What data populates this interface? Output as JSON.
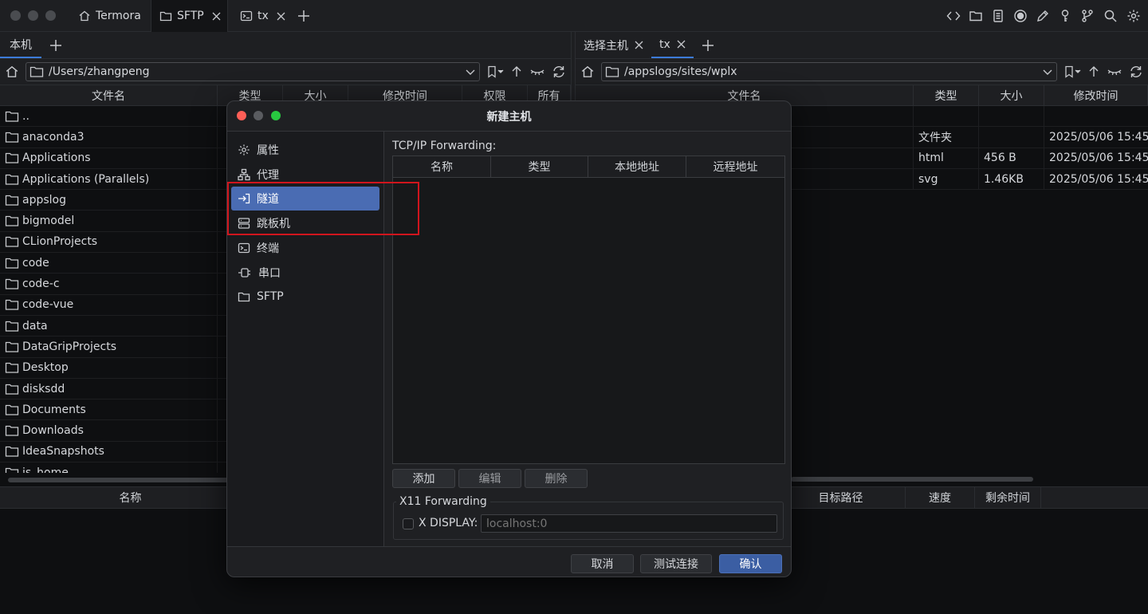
{
  "titlebar": {
    "tabs": [
      {
        "label": "Termora",
        "icon": "home-icon"
      },
      {
        "label": "SFTP",
        "icon": "folder-icon"
      },
      {
        "label": "tx",
        "icon": "terminal-icon"
      }
    ],
    "right_icons": [
      "code-icon",
      "folder-icon",
      "document-icon",
      "record-icon",
      "pen-icon",
      "key-icon",
      "git-branch-icon",
      "search-icon",
      "gear-icon"
    ]
  },
  "left_pane": {
    "tab_label": "本机",
    "path": "/Users/zhangpeng",
    "columns": [
      "文件名",
      "类型",
      "大小",
      "修改时间",
      "权限",
      "所有"
    ],
    "files": [
      "..",
      "anaconda3",
      "Applications",
      "Applications (Parallels)",
      "appslog",
      "bigmodel",
      "CLionProjects",
      "code",
      "code-c",
      "code-vue",
      "data",
      "DataGripProjects",
      "Desktop",
      "disksdd",
      "Documents",
      "Downloads",
      "IdeaSnapshots",
      "js_home"
    ]
  },
  "right_pane": {
    "tabs": [
      "选择主机",
      "tx"
    ],
    "path": "/appslogs/sites/wplx",
    "columns": [
      "文件名",
      "类型",
      "大小",
      "修改时间"
    ],
    "rows": [
      {
        "type": "文件夹",
        "size": "",
        "modified": "2025/05/06 15:45"
      },
      {
        "type": "html",
        "size": "456 B",
        "modified": "2025/05/06 15:45"
      },
      {
        "type": "svg",
        "size": "1.46KB",
        "modified": "2025/05/06 15:45"
      }
    ]
  },
  "transfers": {
    "columns": [
      "名称",
      "目标路径",
      "速度",
      "剩余时间"
    ]
  },
  "dialog": {
    "title": "新建主机",
    "nav": [
      {
        "label": "属性",
        "icon": "gear-icon"
      },
      {
        "label": "代理",
        "icon": "network-icon"
      },
      {
        "label": "隧道",
        "icon": "tunnel-icon",
        "selected": true
      },
      {
        "label": "跳板机",
        "icon": "server-icon"
      },
      {
        "label": "终端",
        "icon": "terminal-icon"
      },
      {
        "label": "串口",
        "icon": "plug-icon"
      },
      {
        "label": "SFTP",
        "icon": "folder-icon"
      }
    ],
    "forwarding_label": "TCP/IP Forwarding:",
    "table_columns": [
      "名称",
      "类型",
      "本地地址",
      "远程地址"
    ],
    "table_buttons": [
      "添加",
      "编辑",
      "删除"
    ],
    "x11_label": "X11 Forwarding",
    "x_display_label": "X DISPLAY:",
    "x_display_placeholder": "localhost:0",
    "x_display_checked": false,
    "footer_buttons": {
      "cancel": "取消",
      "test": "测试连接",
      "confirm": "确认"
    }
  },
  "colors": {
    "accent": "#4a6cb3",
    "highlight_box": "#d0151d",
    "primary_button": "#3b5ea3"
  }
}
